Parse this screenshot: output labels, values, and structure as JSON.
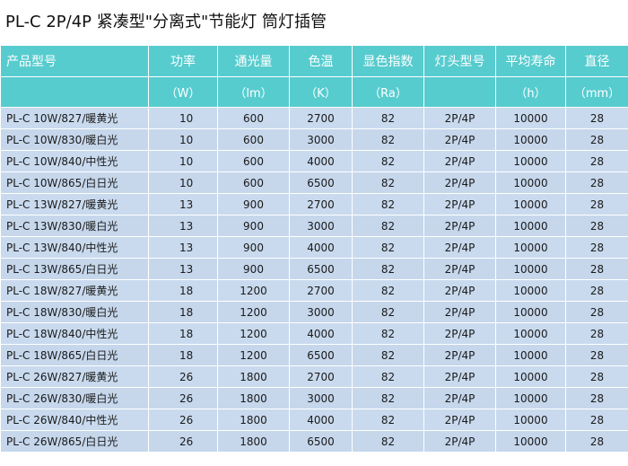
{
  "title": "PL-C 2P/4P 紧凑型\"分离式\"节能灯 筒灯插管",
  "headers": [
    "产品型号",
    "功率",
    "通光量",
    "色温",
    "显色指数",
    "灯头型号",
    "平均寿命",
    "直径"
  ],
  "units": [
    "",
    "（W）",
    "（lm）",
    "（K）",
    "（Ra）",
    "",
    "（h）",
    "（mm）"
  ],
  "rows": [
    [
      "PL-C 10W/827/暖黄光",
      "10",
      "600",
      "2700",
      "82",
      "2P/4P",
      "10000",
      "28"
    ],
    [
      "PL-C 10W/830/暖白光",
      "10",
      "600",
      "3000",
      "82",
      "2P/4P",
      "10000",
      "28"
    ],
    [
      "PL-C 10W/840/中性光",
      "10",
      "600",
      "4000",
      "82",
      "2P/4P",
      "10000",
      "28"
    ],
    [
      "PL-C 10W/865/白日光",
      "10",
      "600",
      "6500",
      "82",
      "2P/4P",
      "10000",
      "28"
    ],
    [
      "PL-C 13W/827/暖黄光",
      "13",
      "900",
      "2700",
      "82",
      "2P/4P",
      "10000",
      "28"
    ],
    [
      "PL-C 13W/830/暖白光",
      "13",
      "900",
      "3000",
      "82",
      "2P/4P",
      "10000",
      "28"
    ],
    [
      "PL-C 13W/840/中性光",
      "13",
      "900",
      "4000",
      "82",
      "2P/4P",
      "10000",
      "28"
    ],
    [
      "PL-C 13W/865/白日光",
      "13",
      "900",
      "6500",
      "82",
      "2P/4P",
      "10000",
      "28"
    ],
    [
      "PL-C 18W/827/暖黄光",
      "18",
      "1200",
      "2700",
      "82",
      "2P/4P",
      "10000",
      "28"
    ],
    [
      "PL-C 18W/830/暖白光",
      "18",
      "1200",
      "3000",
      "82",
      "2P/4P",
      "10000",
      "28"
    ],
    [
      "PL-C 18W/840/中性光",
      "18",
      "1200",
      "4000",
      "82",
      "2P/4P",
      "10000",
      "28"
    ],
    [
      "PL-C 18W/865/白日光",
      "18",
      "1200",
      "6500",
      "82",
      "2P/4P",
      "10000",
      "28"
    ],
    [
      "PL-C 26W/827/暖黄光",
      "26",
      "1800",
      "2700",
      "82",
      "2P/4P",
      "10000",
      "28"
    ],
    [
      "PL-C 26W/830/暖白光",
      "26",
      "1800",
      "3000",
      "82",
      "2P/4P",
      "10000",
      "28"
    ],
    [
      "PL-C 26W/840/中性光",
      "26",
      "1800",
      "4000",
      "82",
      "2P/4P",
      "10000",
      "28"
    ],
    [
      "PL-C 26W/865/白日光",
      "26",
      "1800",
      "6500",
      "82",
      "2P/4P",
      "10000",
      "28"
    ]
  ],
  "colors": {
    "header_bg": "#57cccf",
    "row_bg": "#c6d7ec",
    "header_text": "#ffffff"
  }
}
